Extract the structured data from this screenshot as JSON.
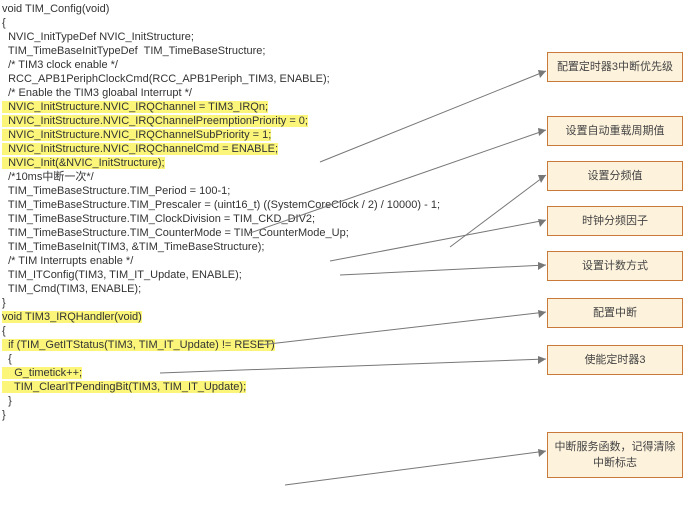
{
  "code": {
    "fn_sig": "void TIM_Config(void)",
    "brace_open": "{",
    "l1": "  NVIC_InitTypeDef NVIC_InitStructure;",
    "l2": "  TIM_TimeBaseInitTypeDef  TIM_TimeBaseStructure;",
    "blank1": "",
    "l3": "  /* TIM3 clock enable */",
    "l4": "  RCC_APB1PeriphClockCmd(RCC_APB1Periph_TIM3, ENABLE);",
    "blank2": "",
    "l5": "  /* Enable the TIM3 gloabal Interrupt */",
    "l6": "  NVIC_InitStructure.NVIC_IRQChannel = TIM3_IRQn;",
    "l7": "  NVIC_InitStructure.NVIC_IRQChannelPreemptionPriority = 0;",
    "l8": "  NVIC_InitStructure.NVIC_IRQChannelSubPriority = 1;",
    "l9": "  NVIC_InitStructure.NVIC_IRQChannelCmd = ENABLE;",
    "l10": "  NVIC_Init(&NVIC_InitStructure);",
    "blank3": "",
    "l11": "  /*10ms中断一次*/",
    "l12": "  TIM_TimeBaseStructure.TIM_Period = 100-1;",
    "l13": "  TIM_TimeBaseStructure.TIM_Prescaler = (uint16_t) ((SystemCoreClock / 2) / 10000) - 1;",
    "l14": "  TIM_TimeBaseStructure.TIM_ClockDivision = TIM_CKD_DIV2;",
    "l15": "  TIM_TimeBaseStructure.TIM_CounterMode = TIM_CounterMode_Up;",
    "blank4": "",
    "l16": "  TIM_TimeBaseInit(TIM3, &TIM_TimeBaseStructure);",
    "blank5": "",
    "l17": "  /* TIM Interrupts enable */",
    "l18": "  TIM_ITConfig(TIM3, TIM_IT_Update, ENABLE);",
    "blank6": "",
    "l19": "  TIM_Cmd(TIM3, ENABLE);",
    "brace_close": "}",
    "blank7": "",
    "fn2_sig": "void TIM3_IRQHandler(void)",
    "fn2_open": "{",
    "l20": "  if (TIM_GetITStatus(TIM3, TIM_IT_Update) != RESET)",
    "l21": "  {",
    "l22": "    G_timetick++;",
    "l23": "    TIM_ClearITPendingBit(TIM3, TIM_IT_Update);",
    "l24": "  }",
    "fn2_close": "}"
  },
  "annotations": {
    "a1": "配置定时器3中断优先级",
    "a2": "设置自动重载周期值",
    "a3": "设置分频值",
    "a4": "时钟分频因子",
    "a5": "设置计数方式",
    "a6": "配置中断",
    "a7": "使能定时器3",
    "a8": "中断服务函数，记得清除中断标志"
  }
}
